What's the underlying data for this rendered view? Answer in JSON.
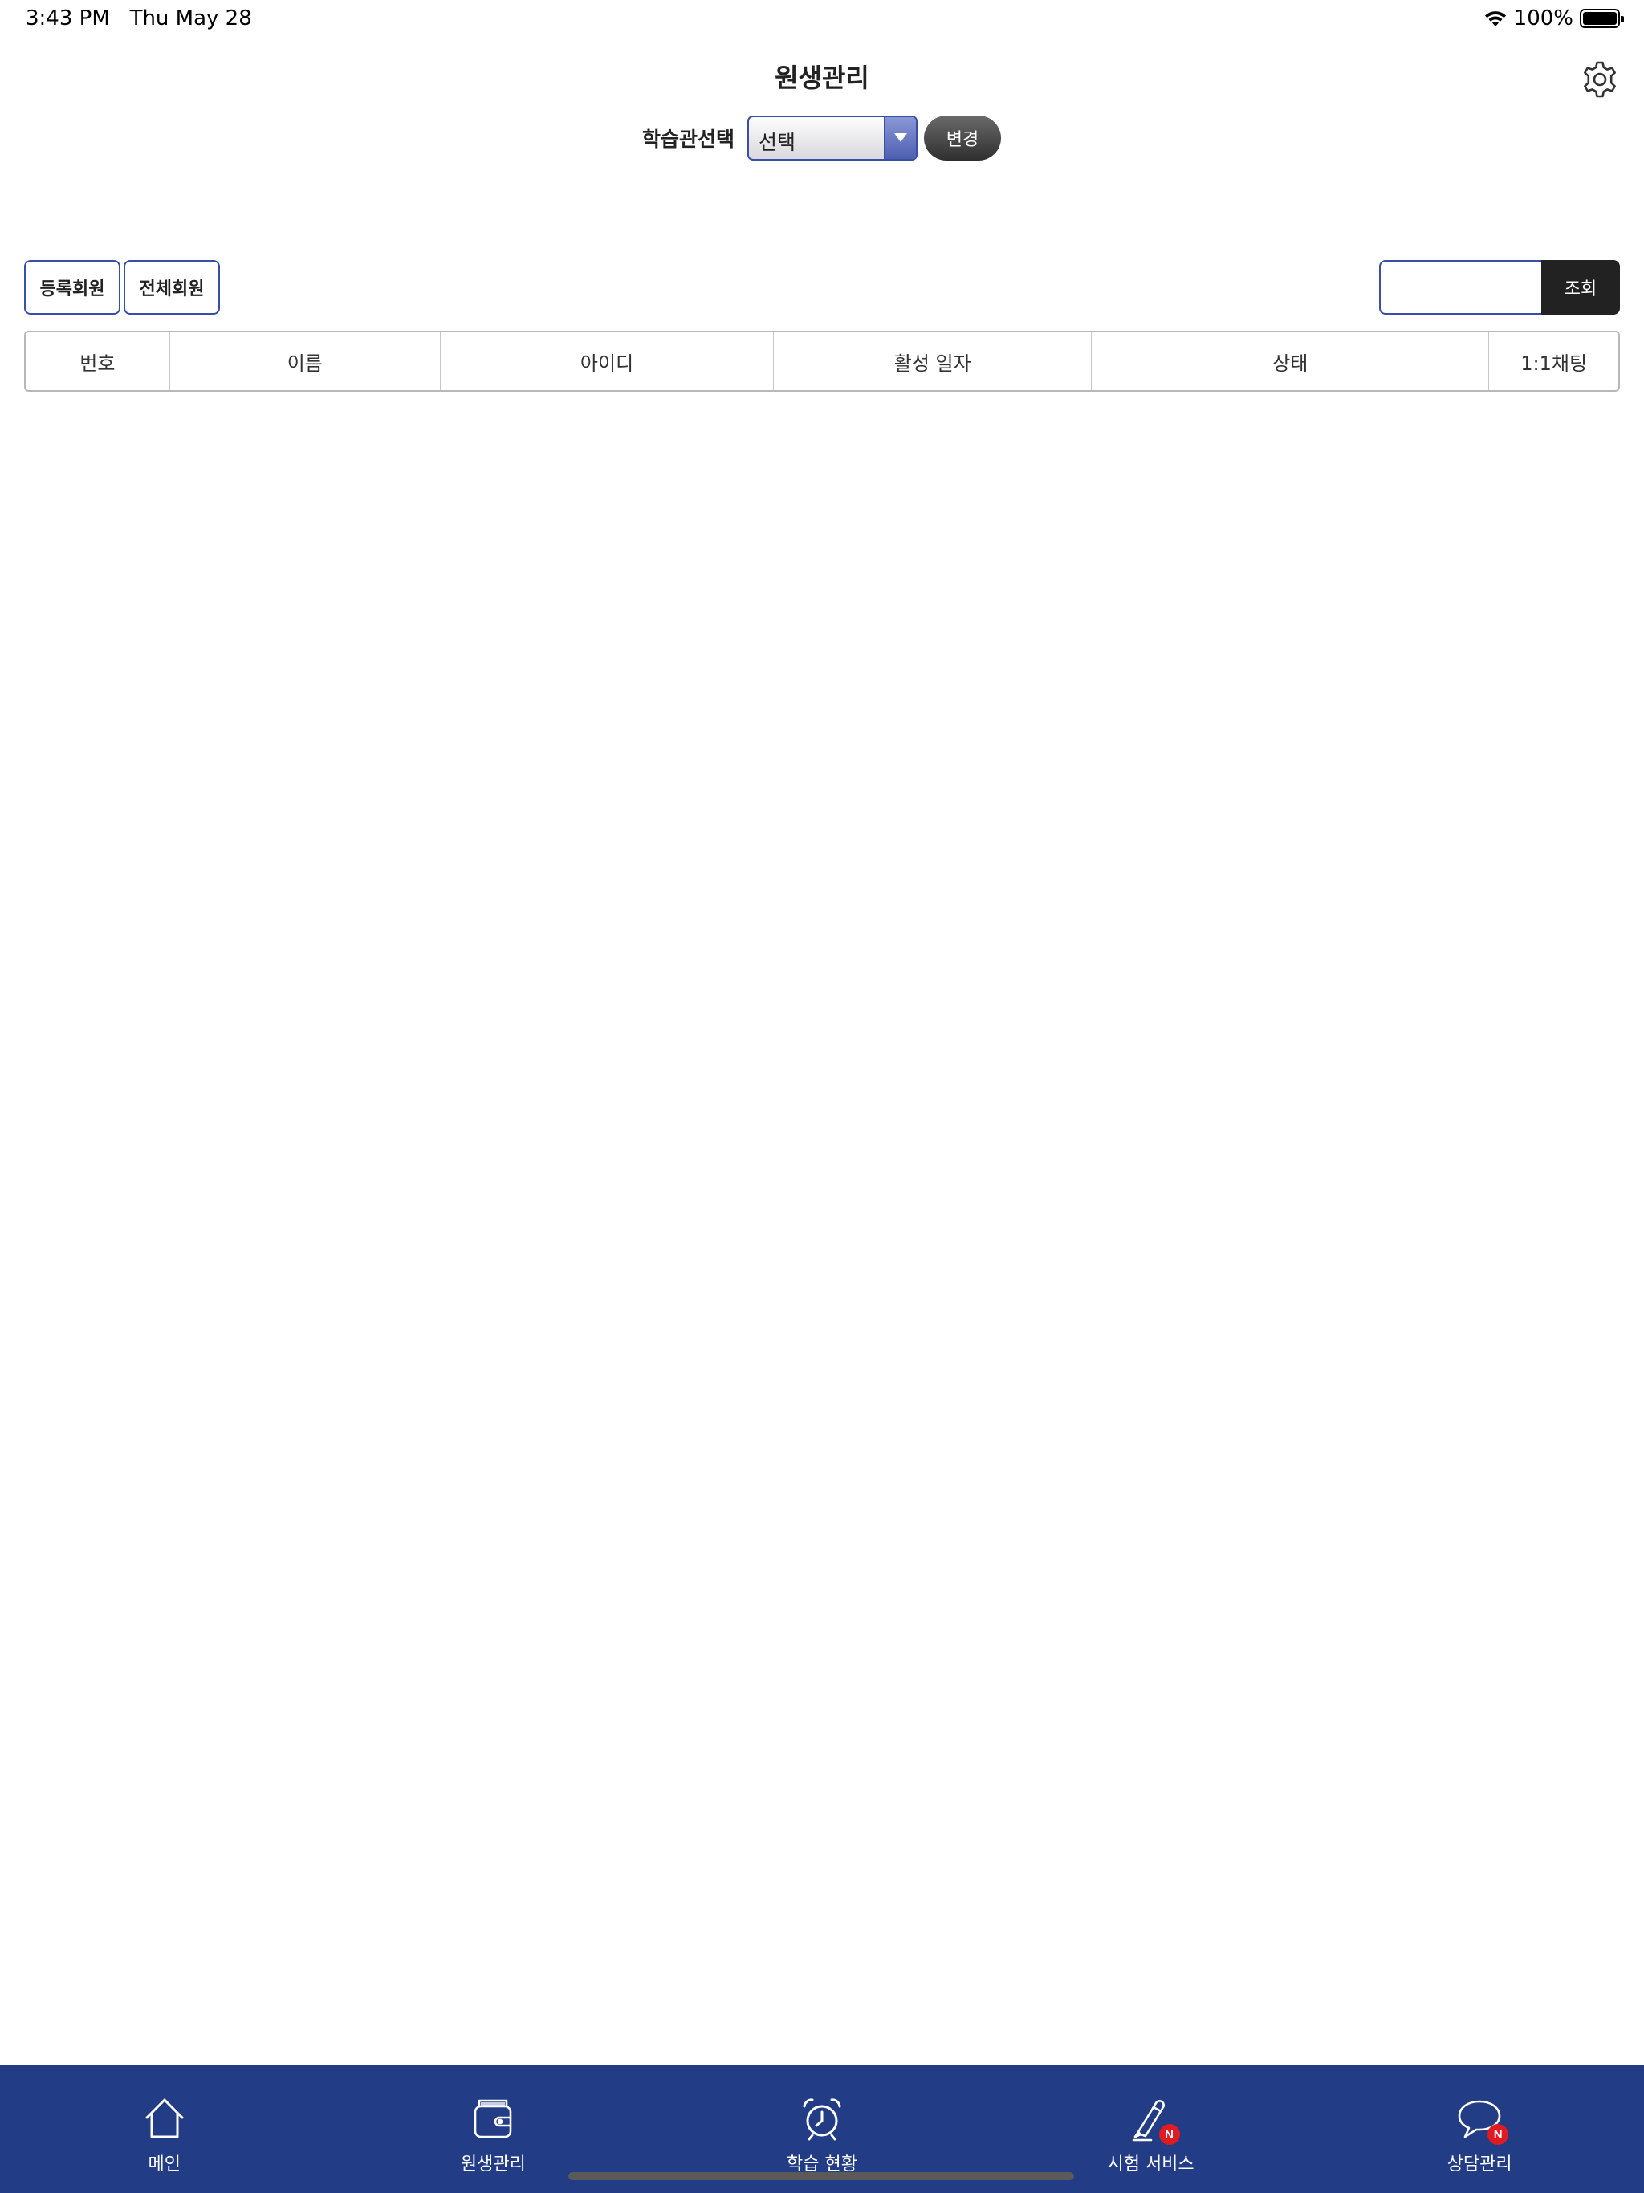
{
  "status_bar": {
    "time": "3:43 PM",
    "date": "Thu May 28",
    "battery": "100%"
  },
  "header": {
    "title": "원생관리",
    "settings_icon": "gear-icon"
  },
  "center_select": {
    "label": "학습관선택",
    "selected": "선택",
    "change_label": "변경"
  },
  "filters": {
    "registered_label": "등록회원",
    "all_label": "전체회원"
  },
  "search": {
    "value": "",
    "placeholder": "",
    "button_label": "조회"
  },
  "table": {
    "columns": [
      "번호",
      "이름",
      "아이디",
      "활성 일자",
      "상태",
      "1:1채팅"
    ],
    "rows": []
  },
  "tabbar": {
    "items": [
      {
        "label": "메인",
        "icon": "home-icon"
      },
      {
        "label": "원생관리",
        "icon": "wallet-icon"
      },
      {
        "label": "학습 현황",
        "icon": "alarm-clock-icon"
      },
      {
        "label": "시험 서비스",
        "icon": "pencil-icon",
        "badge": "N"
      },
      {
        "label": "상담관리",
        "icon": "chat-bubble-icon",
        "badge": "N"
      }
    ]
  },
  "colors": {
    "accent": "#3a4ea8",
    "tabbar_bg": "#233c86",
    "badge": "#e01b22"
  }
}
